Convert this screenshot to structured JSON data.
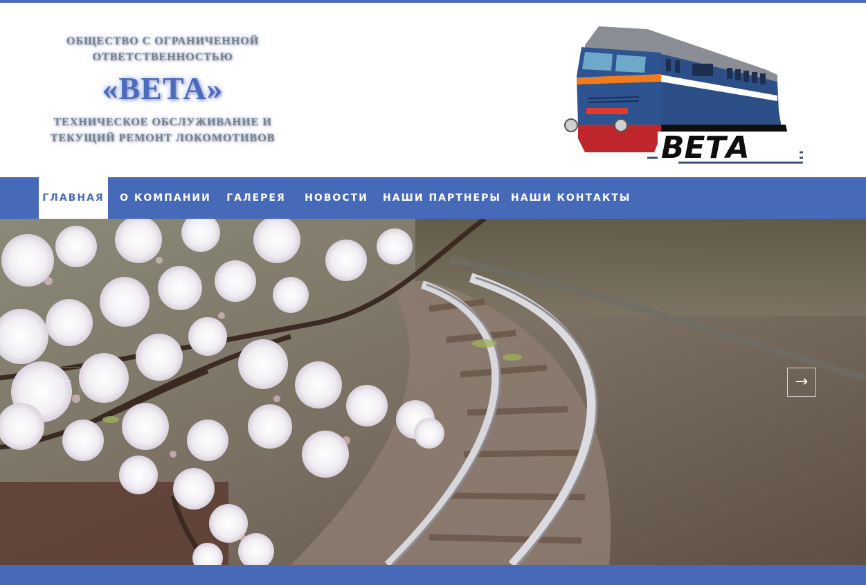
{
  "header": {
    "company_type": "ОБЩЕСТВО С ОГРАНИЧЕННОЙ ОТВЕТСТВЕННОСТЬЮ",
    "company_name": "«ВЕТА»",
    "company_activity": "ТЕХНИЧЕСКОЕ ОБСЛУЖИВАНИЕ И ТЕКУЩИЙ РЕМОНТ ЛОКОМОТИВОВ",
    "logo_text": "ВЕТА"
  },
  "nav": {
    "items": [
      {
        "label": "ГЛАВНАЯ",
        "active": true
      },
      {
        "label": "О КОМПАНИИ",
        "active": false
      },
      {
        "label": "ГАЛЕРЕЯ",
        "active": false
      },
      {
        "label": "НОВОСТИ",
        "active": false
      },
      {
        "label": "НАШИ ПАРТНЕРЫ",
        "active": false
      },
      {
        "label": "НАШИ КОНТАКТЫ",
        "active": false
      }
    ]
  },
  "slider": {
    "prev_icon": "arrow-left-icon",
    "next_icon": "arrow-right-icon",
    "prev_glyph": "←",
    "next_glyph": "→",
    "image_description_icon": "railway-cherry-blossom-photo"
  },
  "colors": {
    "brand_blue": "#4669b8",
    "white": "#ffffff",
    "logo_red": "#c0272d",
    "logo_loco_blue": "#2b4f86",
    "logo_orange": "#f07c1e"
  }
}
